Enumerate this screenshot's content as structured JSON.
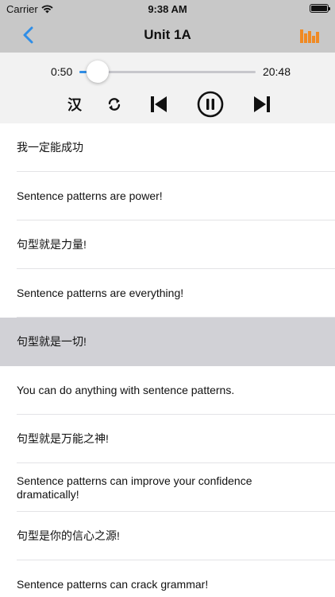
{
  "status_bar": {
    "carrier": "Carrier",
    "time": "9:38 AM"
  },
  "nav": {
    "title": "Unit 1A",
    "back_icon": "chevron-left-icon",
    "playlist_icon": "bars-icon",
    "accent_color": "#2f8ee7",
    "playlist_color": "#f08a24"
  },
  "player": {
    "current_time": "0:50",
    "total_time": "20:48",
    "progress": 0.04,
    "language_toggle": "汉",
    "controls": [
      "chinese-toggle",
      "repeat-icon",
      "previous-track-icon",
      "pause-icon",
      "next-track-icon"
    ]
  },
  "sentences": [
    {
      "text": "我一定能成功",
      "selected": false
    },
    {
      "text": "Sentence patterns are power!",
      "selected": false
    },
    {
      "text": "句型就是力量!",
      "selected": false
    },
    {
      "text": "Sentence patterns are everything!",
      "selected": false
    },
    {
      "text": "句型就是一切!",
      "selected": true
    },
    {
      "text": "You can do anything with sentence patterns.",
      "selected": false
    },
    {
      "text": "句型就是万能之神!",
      "selected": false
    },
    {
      "text": "Sentence patterns can improve your confidence dramatically!",
      "selected": false
    },
    {
      "text": "句型是你的信心之源!",
      "selected": false
    },
    {
      "text": "Sentence patterns can crack grammar!",
      "selected": false
    }
  ],
  "colors": {
    "header_bg": "#c8c8c8",
    "player_bg": "#f2f2f2",
    "selected_row": "#d1d1d6"
  }
}
